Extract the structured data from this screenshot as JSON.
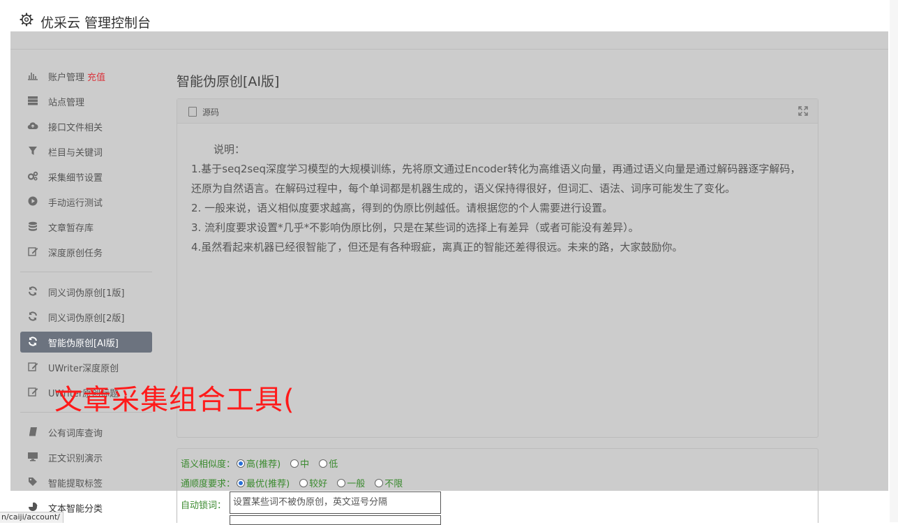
{
  "header": {
    "title": "优采云 管理控制台",
    "icon": "gear-icon"
  },
  "sidebar": {
    "items": [
      {
        "label": "账户管理",
        "extra": "充值",
        "icon": "bar-chart-icon"
      },
      {
        "label": "站点管理",
        "icon": "server-icon"
      },
      {
        "label": "接口文件相关",
        "icon": "cloud-upload-icon"
      },
      {
        "label": "栏目与关键词",
        "icon": "filter-icon"
      },
      {
        "label": "采集细节设置",
        "icon": "cogs-icon"
      },
      {
        "label": "手动运行测试",
        "icon": "play-circle-icon"
      },
      {
        "label": "文章暂存库",
        "icon": "database-icon"
      },
      {
        "label": "深度原创任务",
        "icon": "edit-icon"
      },
      {
        "label": "同义词伪原创[1版]",
        "icon": "refresh-icon"
      },
      {
        "label": "同义词伪原创[2版]",
        "icon": "refresh-icon"
      },
      {
        "label": "智能伪原创[AI版]",
        "icon": "refresh-icon",
        "active": true
      },
      {
        "label": "UWriter深度原创",
        "icon": "edit-icon"
      },
      {
        "label": "UWriter原创标题",
        "icon": "edit-icon"
      },
      {
        "label": "公有词库查询",
        "icon": "book-icon"
      },
      {
        "label": "正文识别演示",
        "icon": "monitor-icon"
      },
      {
        "label": "智能提取标签",
        "icon": "tag-icon"
      },
      {
        "label": "文本智能分类",
        "icon": "pie-chart-icon"
      }
    ]
  },
  "main": {
    "title": "智能伪原创[AI版]",
    "panel": {
      "source_label": "源码",
      "description": [
        "说明：",
        "1.基于seq2seq深度学习模型的大规模训练，先将原文通过Encoder转化为高维语义向量，再通过语义向量是通过解码器逐字解码，还原为自然语言。在解码过程中，每个单词都是机器生成的，语义保持得很好，但词汇、语法、词序可能发生了变化。",
        "2. 一般来说，语义相似度要求越高，得到的伪原比例越低。请根据您的个人需要进行设置。",
        "3. 流利度要求设置*几乎*不影响伪原比例，只是在某些词的选择上有差异（或者可能没有差异）。",
        "4.虽然看起来机器已经很智能了，但还是有各种瑕疵，离真正的智能还差得很远。未来的路，大家鼓励你。"
      ]
    },
    "options": {
      "similarity": {
        "label": "语义相似度：",
        "choices": [
          "高(推荐)",
          "中",
          "低"
        ],
        "selected": "高(推荐)"
      },
      "fluency": {
        "label": "通顺度要求：",
        "choices": [
          "最优(推荐)",
          "较好",
          "一般",
          "不限"
        ],
        "selected": "最优(推荐)"
      },
      "lock": {
        "label": "自动锁词：",
        "placeholder": "设置某些词不被伪原创，英文逗号分隔"
      }
    }
  },
  "watermark": "文章采集组合工具(",
  "status_url": "n/caiji/account/",
  "colors": {
    "overlay": "#cccccc",
    "active_nav": "#6c737f",
    "recharge": "#d9363e",
    "option_text": "#3a8a2e",
    "watermark": "#ff1a1a"
  }
}
